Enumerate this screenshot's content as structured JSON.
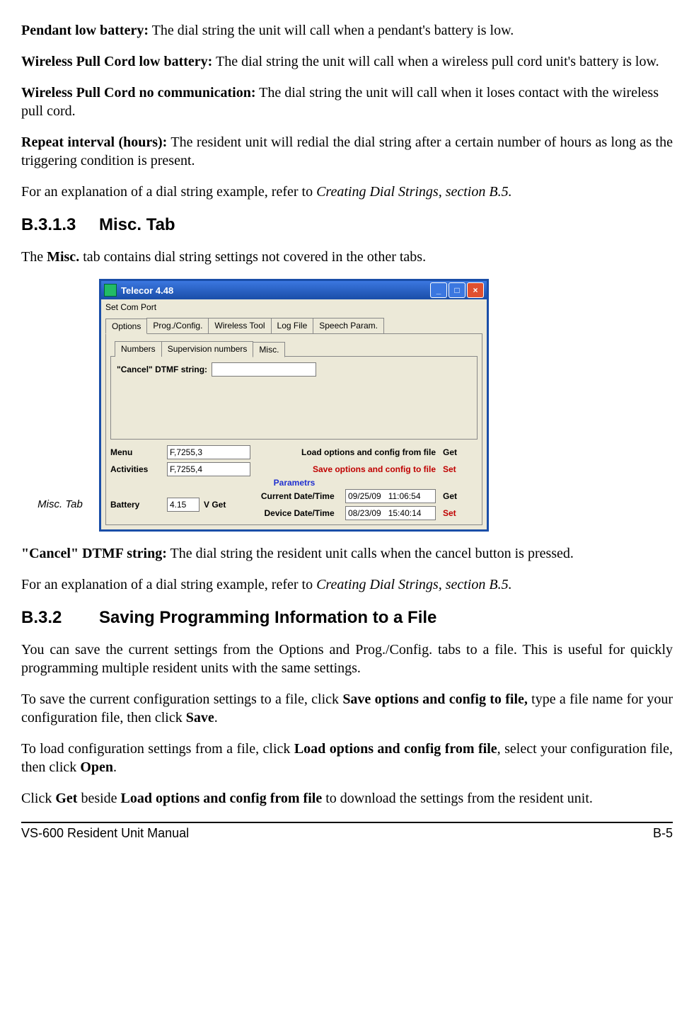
{
  "para1": {
    "bold": "Pendant low battery:",
    "text": " The dial string the unit will call when a pendant's battery is low."
  },
  "para2": {
    "bold": "Wireless Pull Cord low battery:",
    "text": " The dial string the unit will call when a wireless pull cord unit's battery is low."
  },
  "para3": {
    "bold": "Wireless Pull Cord no communication:",
    "text": " The dial string the unit will call when it loses contact with the wireless pull cord."
  },
  "para4": {
    "bold": "Repeat interval (hours):",
    "text": " The resident unit will redial the dial string after a certain number of hours as long as the triggering condition is present."
  },
  "para5": {
    "pre": "For an explanation of a dial string example, refer to ",
    "ital": "Creating Dial Strings, section B.5."
  },
  "h1": {
    "num": "B.3.1.3",
    "title": "Misc. Tab"
  },
  "para6": {
    "pre": "The ",
    "bold": "Misc.",
    "post": " tab contains dial string settings not covered in the other tabs."
  },
  "figcap": "Misc. Tab",
  "app": {
    "title": "Telecor 4.48",
    "menu": "Set Com Port",
    "outerTabs": [
      "Options",
      "Prog./Config.",
      "Wireless Tool",
      "Log File",
      "Speech Param."
    ],
    "innerTabs": [
      "Numbers",
      "Supervision numbers",
      "Misc."
    ],
    "cancelLabel": "\"Cancel\" DTMF string:",
    "menuLabel": "Menu",
    "menuVal": "F,7255,3",
    "actLabel": "Activities",
    "actVal": "F,7255,4",
    "paramLabel": "Parametrs",
    "batLabel": "Battery",
    "batVal": "4.15",
    "batUnit": "V   Get",
    "loadLabel": "Load  options and config from file",
    "saveLabel": "Save options and config to file",
    "curDateLabel": "Current Date/Time",
    "curDateVal": "09/25/09   11:06:54",
    "devDateLabel": "Device Date/Time",
    "devDateVal": "08/23/09   15:40:14",
    "get": "Get",
    "set": "Set"
  },
  "para7": {
    "bold": "\"Cancel\" DTMF string:",
    "text": " The dial string the resident unit calls when the cancel button is pressed."
  },
  "para8": {
    "pre": "For an explanation of a dial string example, refer to ",
    "ital": "Creating Dial Strings, section B.5."
  },
  "h2": {
    "num": "B.3.2",
    "title": "Saving Programming Information to a File"
  },
  "para9": "You can save the current settings from the Options and Prog./Config. tabs to a file.  This is useful for quickly programming multiple resident units with the same settings.",
  "para10": {
    "p1": "To save the current configuration settings to a file, click ",
    "b1": "Save options and config to file,",
    "p2": " type a file name for your configuration file, then click ",
    "b2": "Save",
    "p3": "."
  },
  "para11": {
    "p1": "To load configuration settings from a file, click ",
    "b1": "Load options and config from file",
    "p2": ", select your configuration file, then click ",
    "b2": "Open",
    "p3": "."
  },
  "para12": {
    "p1": "Click ",
    "b1": "Get",
    "p2": " beside ",
    "b2": "Load options and config from file",
    "p3": " to download the settings from the resident unit."
  },
  "footer": {
    "left": "VS-600 Resident Unit Manual",
    "right": "B-5"
  }
}
